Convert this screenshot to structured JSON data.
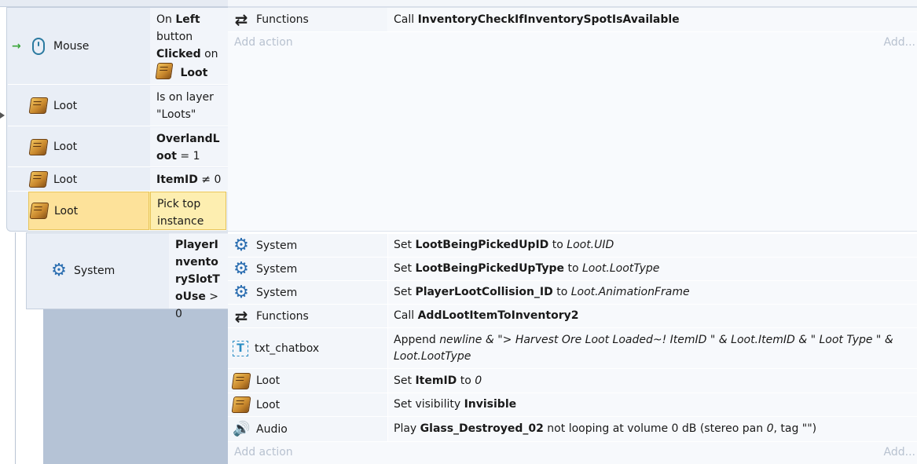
{
  "event1": {
    "conditions": [
      {
        "object": "Mouse",
        "icon": "mouse-icon",
        "parts": [
          [
            "On ",
            ""
          ],
          [
            "Left",
            "b"
          ],
          [
            " button ",
            ""
          ],
          [
            "Clicked",
            "b"
          ],
          [
            " on ",
            ""
          ]
        ],
        "target": "Loot",
        "trigger": "→"
      },
      {
        "object": "Loot",
        "icon": "loot-icon",
        "text": "Is on layer \"Loots\""
      },
      {
        "object": "Loot",
        "icon": "loot-icon",
        "bold": "OverlandLoot",
        "rest": " = 1"
      },
      {
        "object": "Loot",
        "icon": "loot-icon",
        "bold": "ItemID",
        "rest": " ≠ 0"
      },
      {
        "object": "Loot",
        "icon": "loot-icon",
        "text": "Pick top instance",
        "selected": true
      }
    ],
    "actions": [
      {
        "object": "Functions",
        "icon": "functions-icon",
        "prefix": "Call ",
        "bold": "InventoryCheckIfInventorySpotIsAvailable"
      }
    ],
    "add_action": "Add action",
    "add_short": "Add..."
  },
  "sub_event": {
    "condition": {
      "object": "System",
      "icon": "gear-icon",
      "bold": "PlayerInventorySlotToUse",
      "rest": " > 0"
    },
    "actions": [
      {
        "object": "System",
        "icon": "gear-icon",
        "segments": [
          [
            "Set ",
            ""
          ],
          [
            "LootBeingPickedUpID",
            "b"
          ],
          [
            " to ",
            ""
          ],
          [
            "Loot.UID",
            "i"
          ]
        ]
      },
      {
        "object": "System",
        "icon": "gear-icon",
        "segments": [
          [
            "Set ",
            ""
          ],
          [
            "LootBeingPickedUpType",
            "b"
          ],
          [
            " to ",
            ""
          ],
          [
            "Loot.LootType",
            "i"
          ]
        ]
      },
      {
        "object": "System",
        "icon": "gear-icon",
        "segments": [
          [
            "Set ",
            ""
          ],
          [
            "PlayerLootCollision_ID",
            "b"
          ],
          [
            " to ",
            ""
          ],
          [
            "Loot.AnimationFrame",
            "i"
          ]
        ]
      },
      {
        "object": "Functions",
        "icon": "functions-icon",
        "segments": [
          [
            "Call ",
            ""
          ],
          [
            "AddLootItemToInventory2",
            "b"
          ]
        ]
      },
      {
        "object": "txt_chatbox",
        "icon": "text-icon",
        "segments": [
          [
            "Append ",
            ""
          ],
          [
            "newline & \"> Harvest Ore Loot Loaded~! ItemID \" & Loot.ItemID & \" Loot Type \" & Loot.LootType",
            "i"
          ]
        ]
      },
      {
        "object": "Loot",
        "icon": "loot-icon",
        "segments": [
          [
            "Set ",
            ""
          ],
          [
            "ItemID",
            "b"
          ],
          [
            " to ",
            ""
          ],
          [
            "0",
            "i"
          ]
        ]
      },
      {
        "object": "Loot",
        "icon": "loot-icon",
        "segments": [
          [
            "Set visibility ",
            ""
          ],
          [
            "Invisible",
            "b"
          ]
        ]
      },
      {
        "object": "Audio",
        "icon": "audio-icon",
        "segments": [
          [
            "Play ",
            ""
          ],
          [
            "Glass_Destroyed_02",
            "b"
          ],
          [
            " not looping at volume 0 dB (stereo pan ",
            ""
          ],
          [
            "0",
            "i"
          ],
          [
            ", tag \"\")",
            ""
          ]
        ]
      }
    ],
    "add_action": "Add action",
    "add_short": "Add..."
  },
  "colors": {
    "selection": "#fde89a",
    "event_bg": "#e9eef6",
    "subevent_grey": "#b5c3d6",
    "add_text": "#b8c2d0"
  }
}
